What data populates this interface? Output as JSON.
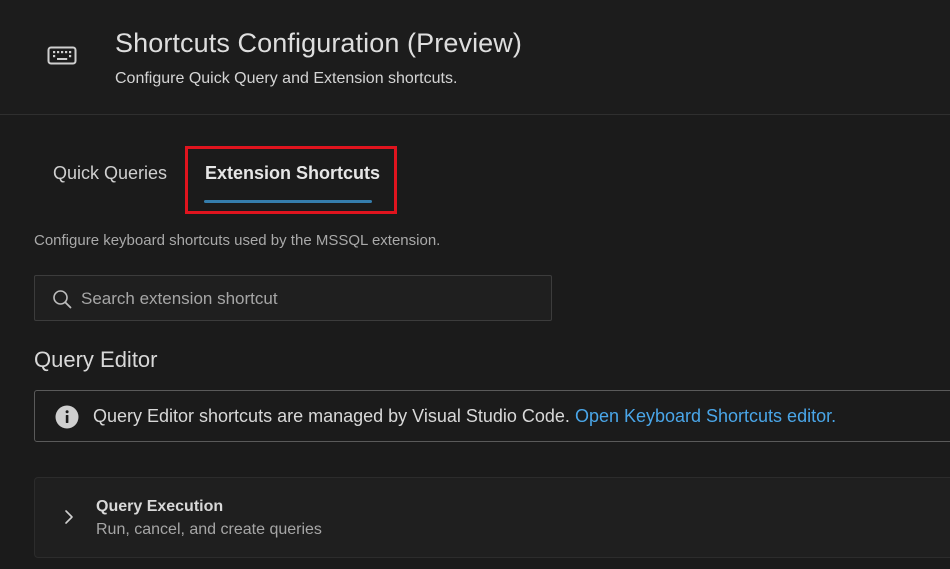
{
  "header": {
    "icon": "keyboard-icon",
    "title": "Shortcuts Configuration (Preview)",
    "subtitle": "Configure Quick Query and Extension shortcuts."
  },
  "tabs": [
    {
      "label": "Quick Queries",
      "selected": false
    },
    {
      "label": "Extension Shortcuts",
      "selected": true
    }
  ],
  "description": "Configure keyboard shortcuts used by the MSSQL extension.",
  "search": {
    "icon": "search-icon",
    "placeholder": "Search extension shortcut",
    "value": ""
  },
  "section": {
    "title": "Query Editor",
    "info": {
      "icon": "info-icon",
      "text": "Query Editor shortcuts are managed by Visual Studio Code. ",
      "link": "Open Keyboard Shortcuts editor."
    },
    "groups": [
      {
        "icon": "chevron-right-icon",
        "title": "Query Execution",
        "subtitle": "Run, cancel, and create queries"
      }
    ]
  },
  "colors": {
    "accent": "#3a8ec6",
    "link": "#4aa6e8",
    "highlight": "#e0141e",
    "background": "#1b1b1b"
  }
}
